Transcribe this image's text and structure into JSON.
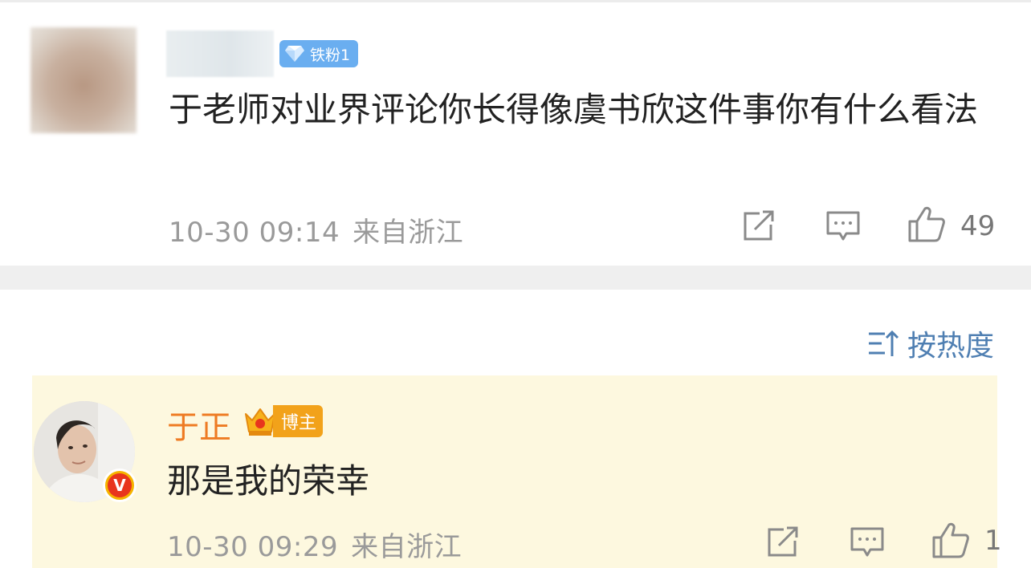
{
  "comment": {
    "fan_badge": "铁粉1",
    "text": "于老师对业界评论你长得像虞书欣这件事你有什么看法",
    "date": "10-30 09:14",
    "location": "来自浙江",
    "likes": "49"
  },
  "sort": {
    "label": "按热度"
  },
  "reply": {
    "author": "于正",
    "author_badge": "博主",
    "verified": "V",
    "text": "那是我的荣幸",
    "date": "10-30 09:29",
    "location": "来自浙江",
    "likes": "1"
  },
  "colors": {
    "author_name": "#ee7b23",
    "sort_accent": "#4f7fb2",
    "reply_background": "#fdf8df",
    "fan_badge": "#6aaef0"
  },
  "icons": [
    "diamond-icon",
    "share-icon",
    "comment-icon",
    "like-icon",
    "sort-icon",
    "crown-icon",
    "verified-icon"
  ]
}
